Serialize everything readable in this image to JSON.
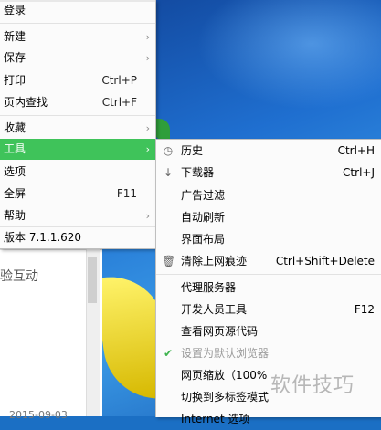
{
  "background": {
    "page_snippet": "验互动",
    "page_date": "2015-09-03"
  },
  "main_menu": {
    "items": [
      {
        "label": "登录",
        "accel": "",
        "arrow": ""
      },
      {
        "label": "新建",
        "accel": "",
        "arrow": "›"
      },
      {
        "label": "保存",
        "accel": "",
        "arrow": "›"
      },
      {
        "label": "打印",
        "accel": "Ctrl+P",
        "arrow": ""
      },
      {
        "label": "页内查找",
        "accel": "Ctrl+F",
        "arrow": ""
      },
      {
        "label": "收藏",
        "accel": "",
        "arrow": "›"
      },
      {
        "label": "工具",
        "accel": "",
        "arrow": "›"
      },
      {
        "label": "选项",
        "accel": "",
        "arrow": ""
      },
      {
        "label": "全屏",
        "accel": "F11",
        "arrow": ""
      },
      {
        "label": "帮助",
        "accel": "",
        "arrow": "›"
      },
      {
        "label": "版本 7.1.1.620",
        "accel": "",
        "arrow": ""
      }
    ]
  },
  "tools_submenu": {
    "items": [
      {
        "icon": "clock-icon",
        "glyph": "◷",
        "label": "历史",
        "accel": "Ctrl+H"
      },
      {
        "icon": "download-arrow-icon",
        "glyph": "↓",
        "label": "下载器",
        "accel": "Ctrl+J"
      },
      {
        "icon": "",
        "glyph": "",
        "label": "广告过滤",
        "accel": ""
      },
      {
        "icon": "",
        "glyph": "",
        "label": "自动刷新",
        "accel": ""
      },
      {
        "icon": "",
        "glyph": "",
        "label": "界面布局",
        "accel": ""
      },
      {
        "icon": "trash-icon",
        "glyph": "🗑",
        "label": "清除上网痕迹",
        "accel": "Ctrl+Shift+Delete"
      },
      {
        "icon": "",
        "glyph": "",
        "label": "代理服务器",
        "accel": ""
      },
      {
        "icon": "",
        "glyph": "",
        "label": "开发人员工具",
        "accel": "F12"
      },
      {
        "icon": "",
        "glyph": "",
        "label": "查看网页源代码",
        "accel": ""
      },
      {
        "icon": "checkmark-icon",
        "glyph": "✔",
        "label": "设置为默认浏览器",
        "accel": "",
        "disabled": true
      },
      {
        "icon": "",
        "glyph": "",
        "label": "网页缩放（100%",
        "accel": ""
      },
      {
        "icon": "",
        "glyph": "",
        "label": "切换到多标签模式",
        "accel": ""
      },
      {
        "icon": "",
        "glyph": "",
        "label": "Internet 选项",
        "accel": ""
      }
    ]
  },
  "watermark": "软件技巧",
  "colors": {
    "highlight": "#3fc35a",
    "check": "#3fb34f"
  }
}
